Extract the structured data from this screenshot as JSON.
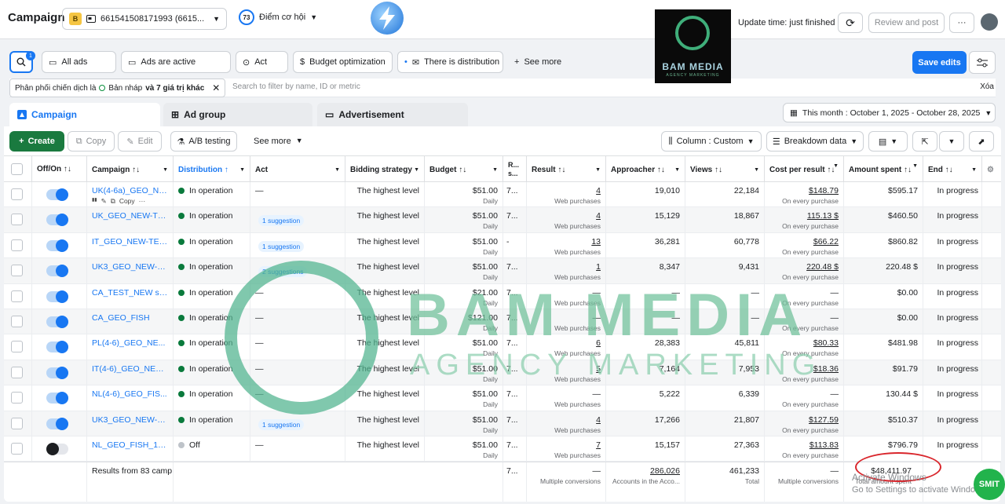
{
  "header": {
    "title": "Campaign",
    "account_badge": "B",
    "account_label": "661541508171993 (6615...",
    "score_value": "73",
    "score_label": "Điểm cơ hội",
    "update_time": "Update time: just finished",
    "review_label": "Review and post",
    "more_label": "···"
  },
  "watermark_logo": {
    "title": "BAM MEDIA",
    "subtitle": "AGENCY MARKETING"
  },
  "filters": {
    "search_badge": "1",
    "chips": [
      "All ads",
      "Ads are active",
      "Act",
      "Budget optimization",
      "There is distribution"
    ],
    "see_more": "See more",
    "save_label": "Save edits",
    "active_filter_prefix": "Phân phối chiến dịch là",
    "active_filter_value": "Bản nháp",
    "active_filter_suffix": "và 7 giá trị khác",
    "search_placeholder": "Search to filter by name, ID or metric",
    "clear_label": "Xóa"
  },
  "tabs": [
    {
      "label": "Campaign"
    },
    {
      "label": "Ad group"
    },
    {
      "label": "Advertisement"
    }
  ],
  "date_range": "This month : October 1, 2025 - October 28, 2025",
  "toolbar": {
    "create": "Create",
    "copy": "Copy",
    "edit": "Edit",
    "ab": "A/B testing",
    "see_more": "See more",
    "column": "Column : Custom",
    "breakdown": "Breakdown data"
  },
  "columns": {
    "onoff": "Off/On",
    "campaign": "Campaign",
    "distribution": "Distribution",
    "act": "Act",
    "bidding": "Bidding strategy",
    "budget": "Budget",
    "rs": "R... s...",
    "result": "Result",
    "approacher": "Approacher",
    "views": "Views",
    "cpr": "Cost per result",
    "spent": "Amount spent",
    "end": "End"
  },
  "row_sub": {
    "copy": "Copy",
    "daily": "Daily",
    "web": "Web purchases",
    "every": "On every purchase"
  },
  "rows": [
    {
      "on": true,
      "name": "UK(4-6a)_GEO_NE...",
      "dist": "In operation",
      "act": "—",
      "sugg": "",
      "bid": "The highest level",
      "budget": "$51.00",
      "rs": "7...",
      "result": "4",
      "appr": "19,010",
      "views": "22,184",
      "cpr": "$148.79",
      "spent": "$595.17",
      "end": "In progress"
    },
    {
      "on": true,
      "name": "UK_GEO_NEW-TE...",
      "dist": "In operation",
      "act": "",
      "sugg": "1 suggestion",
      "bid": "The highest level",
      "budget": "$51.00",
      "rs": "7...",
      "result": "4",
      "appr": "15,129",
      "views": "18,867",
      "cpr": "115.13 $",
      "spent": "$460.50",
      "end": "In progress"
    },
    {
      "on": true,
      "name": "IT_GEO_NEW-TEC...",
      "dist": "In operation",
      "act": "",
      "sugg": "1 suggestion",
      "bid": "The highest level",
      "budget": "$51.00",
      "rs": "-",
      "result": "13",
      "appr": "36,281",
      "views": "60,778",
      "cpr": "$66.22",
      "spent": "$860.82",
      "end": "In progress"
    },
    {
      "on": true,
      "name": "UK3_GEO_NEW-TE...",
      "dist": "In operation",
      "act": "",
      "sugg": "2 suggestions",
      "bid": "The highest level",
      "budget": "$51.00",
      "rs": "7...",
      "result": "1",
      "appr": "8,347",
      "views": "9,431",
      "cpr": "220.48 $",
      "spent": "220.48 $",
      "end": "In progress"
    },
    {
      "on": true,
      "name": "CA_TEST_NEW str...",
      "dist": "In operation",
      "act": "—",
      "sugg": "",
      "bid": "The highest level",
      "budget": "$21.00",
      "rs": "7...",
      "result": "—",
      "appr": "—",
      "views": "—",
      "cpr": "—",
      "spent": "$0.00",
      "end": "In progress"
    },
    {
      "on": true,
      "name": "CA_GEO_FISH",
      "dist": "In operation",
      "act": "—",
      "sugg": "",
      "bid": "The highest level",
      "budget": "$121.00",
      "rs": "7...",
      "result": "—",
      "appr": "—",
      "views": "—",
      "cpr": "—",
      "spent": "$0.00",
      "end": "In progress"
    },
    {
      "on": true,
      "name": "PL(4-6)_GEO_NE...",
      "dist": "In operation",
      "act": "—",
      "sugg": "",
      "bid": "The highest level",
      "budget": "$51.00",
      "rs": "7...",
      "result": "6",
      "appr": "28,383",
      "views": "45,811",
      "cpr": "$80.33",
      "spent": "$481.98",
      "end": "In progress"
    },
    {
      "on": true,
      "name": "IT(4-6)_GEO_NEW-...",
      "dist": "In operation",
      "act": "—",
      "sugg": "",
      "bid": "The highest level",
      "budget": "$51.00",
      "rs": "7...",
      "result": "5",
      "appr": "7,164",
      "views": "7,953",
      "cpr": "$18.36",
      "spent": "$91.79",
      "end": "In progress"
    },
    {
      "on": true,
      "name": "NL(4-6)_GEO_FIS...",
      "dist": "In operation",
      "act": "—",
      "sugg": "",
      "bid": "The highest level",
      "budget": "$51.00",
      "rs": "7...",
      "result": "—",
      "appr": "5,222",
      "views": "6,339",
      "cpr": "—",
      "spent": "130.44 $",
      "end": "In progress"
    },
    {
      "on": true,
      "name": "UK3_GEO_NEW-TE...",
      "dist": "In operation",
      "act": "",
      "sugg": "1 suggestion",
      "bid": "The highest level",
      "budget": "$51.00",
      "rs": "7...",
      "result": "4",
      "appr": "17,266",
      "views": "21,807",
      "cpr": "$127.59",
      "spent": "$510.37",
      "end": "In progress"
    },
    {
      "on": false,
      "name": "NL_GEO_FISH_16.10",
      "dist": "Off",
      "act": "—",
      "sugg": "",
      "bid": "The highest level",
      "budget": "$51.00",
      "rs": "7...",
      "result": "7",
      "appr": "15,157",
      "views": "27,363",
      "cpr": "$113.83",
      "spent": "$796.79",
      "end": "In progress"
    }
  ],
  "totals": {
    "label": "Results from 83 camp",
    "rs": "7...",
    "result": "—",
    "result_sub": "Multiple conversions",
    "appr": "286,026",
    "appr_sub": "Accounts in the Acco...",
    "views": "461,233",
    "views_sub": "Total",
    "cpr": "—",
    "cpr_sub": "Multiple conversions",
    "spent": "$48,411.97",
    "spent_sub": "Total amount spent"
  },
  "overlay": {
    "activate_title": "Activate Windows",
    "activate_sub": "Go to Settings to activate Windows.",
    "smit": "SMIT"
  },
  "colors": {
    "accent": "#1877f2",
    "create": "#1a7a3f",
    "status": "#0a7a3c",
    "circle": "#d9262c"
  }
}
